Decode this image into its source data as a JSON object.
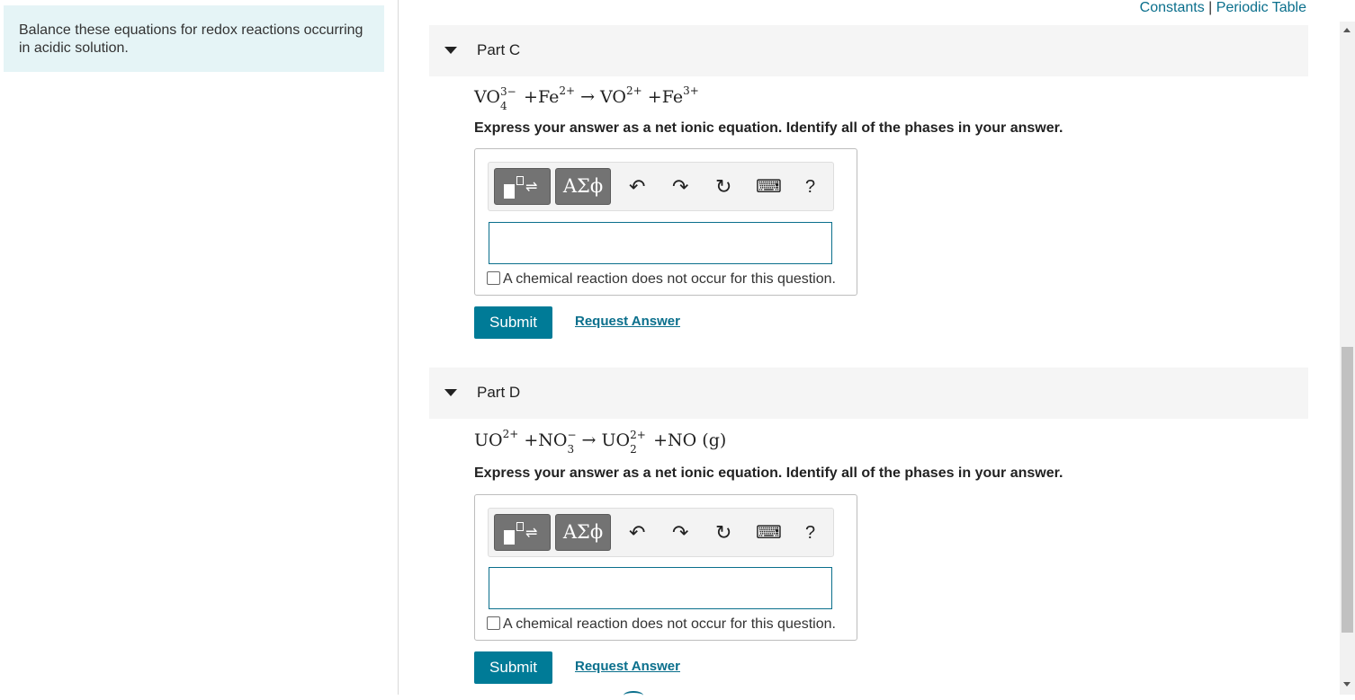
{
  "intro": {
    "text": "Balance these equations for redox reactions occurring in acidic solution."
  },
  "top_links": {
    "constants": "Constants",
    "separator": "|",
    "periodic_table": "Periodic Table"
  },
  "toolbar": {
    "greek_label": "ΑΣϕ",
    "help_label": "?"
  },
  "part_c": {
    "title": "Part C",
    "equation": {
      "r1": "VO",
      "r1_sub": "4",
      "r1_sup": "3−",
      "op1": "+",
      "r2": "Fe",
      "r2_sup": "2+",
      "arrow": "→",
      "p1": "VO",
      "p1_sup": "2+",
      "op2": "+",
      "p2": "Fe",
      "p2_sup": "3+"
    },
    "instruction": "Express your answer as a net ionic equation. Identify all of the phases in your answer.",
    "answer_value": "",
    "no_reaction_label": "A chemical reaction does not occur for this question.",
    "submit_label": "Submit",
    "request_label": "Request Answer"
  },
  "part_d": {
    "title": "Part D",
    "equation": {
      "r1": "UO",
      "r1_sup": "2+",
      "op1": "+",
      "r2": "NO",
      "r2_sub": "3",
      "r2_sup": "−",
      "arrow": "→",
      "p1": "UO",
      "p1_sub": "2",
      "p1_sup": "2+",
      "op2": "+",
      "p2": "NO",
      "p2_phase": "(g)"
    },
    "instruction": "Express your answer as a net ionic equation. Identify all of the phases in your answer.",
    "answer_value": "",
    "no_reaction_label": "A chemical reaction does not occur for this question.",
    "submit_label": "Submit",
    "request_label": "Request Answer"
  },
  "colors": {
    "accent": "#007b97",
    "link": "#0a6f8c",
    "intro_bg": "#e5f4f6",
    "header_bg": "#f5f5f5"
  }
}
